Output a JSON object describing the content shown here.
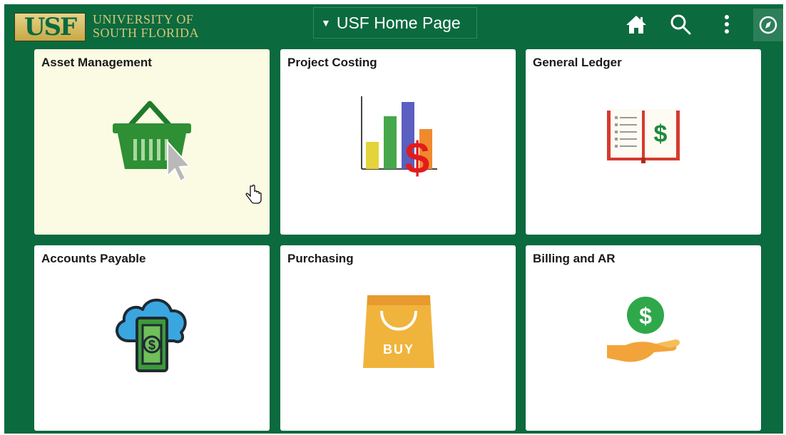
{
  "header": {
    "logo_text": "USF",
    "university_line1": "UNIVERSITY OF",
    "university_line2": "SOUTH FLORIDA",
    "home_selector_label": "USF Home Page",
    "icons": [
      "home-icon",
      "search-icon",
      "more-options-icon",
      "navbar-compass-icon"
    ]
  },
  "tiles": [
    {
      "title": "Asset Management",
      "icon": "shopping-basket-icon",
      "hovered": true
    },
    {
      "title": "Project Costing",
      "icon": "bar-chart-dollar-icon"
    },
    {
      "title": "General Ledger",
      "icon": "ledger-book-icon"
    },
    {
      "title": "Accounts Payable",
      "icon": "cloud-money-icon"
    },
    {
      "title": "Purchasing",
      "icon": "buy-bag-icon",
      "icon_text": "BUY"
    },
    {
      "title": "Billing and AR",
      "icon": "hand-coin-icon"
    }
  ],
  "colors": {
    "brand_green": "#0b6a3e",
    "brand_gold": "#d9c57a",
    "hover_tile": "#fbfae3"
  }
}
